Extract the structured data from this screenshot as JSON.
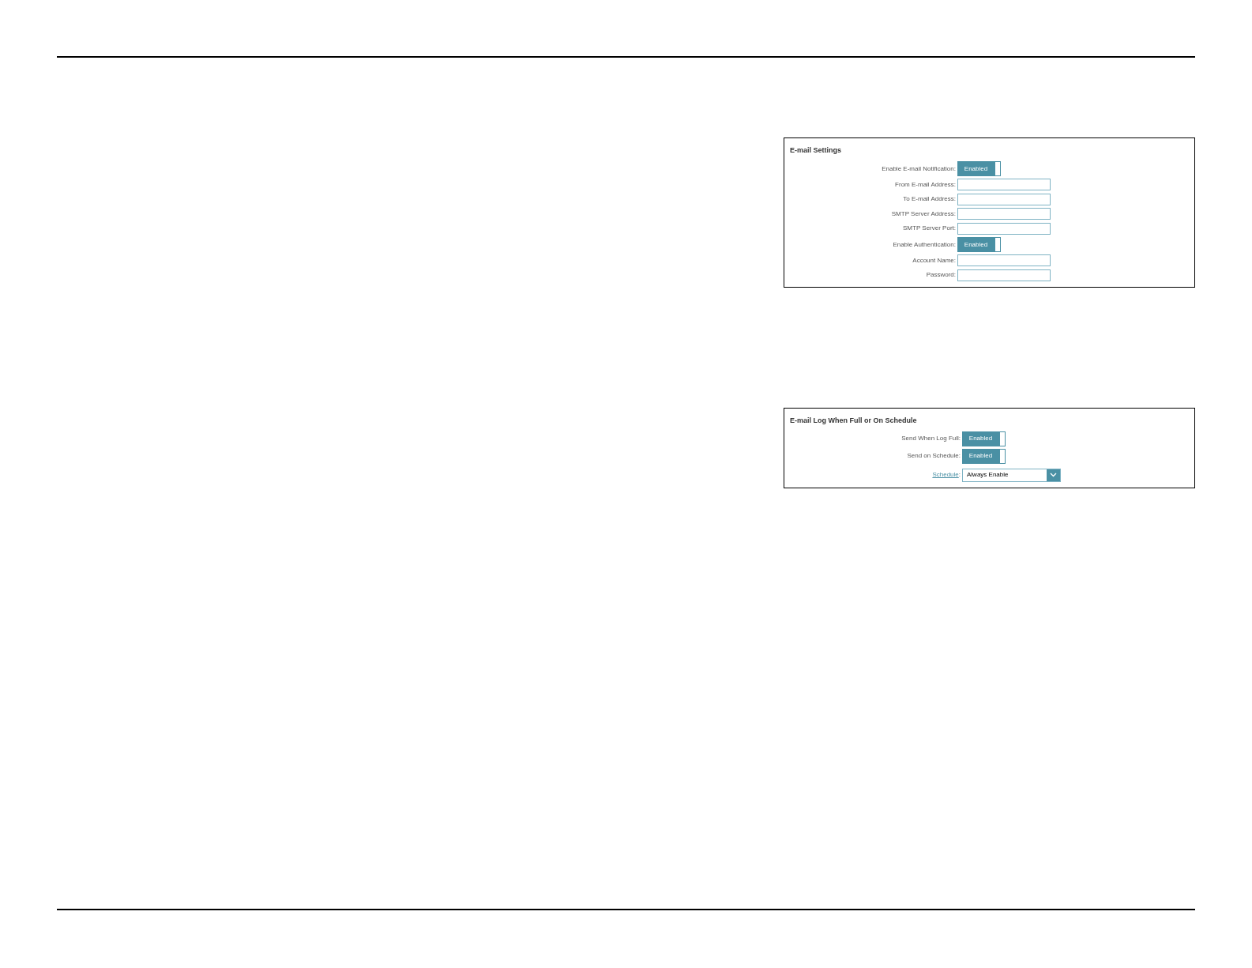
{
  "sections": [
    {
      "title": "E-mail Settings",
      "rows": [
        {
          "kind": "toggle",
          "label": "Enable E-mail Notification:",
          "value": "Enabled",
          "on": true
        },
        {
          "kind": "text",
          "label": "From E-mail Address:"
        },
        {
          "kind": "text",
          "label": "To E-mail Address:"
        },
        {
          "kind": "text",
          "label": "SMTP Server Address:"
        },
        {
          "kind": "text",
          "label": "SMTP Server Port:"
        },
        {
          "kind": "toggle",
          "label": "Enable Authentication:",
          "value": "Enabled",
          "on": true
        },
        {
          "kind": "text",
          "label": "Account Name:"
        },
        {
          "kind": "text",
          "label": "Password:"
        }
      ]
    },
    {
      "title": "E-mail Log When Full or On Schedule",
      "rows": [
        {
          "kind": "toggle",
          "label": "Send When Log Full:",
          "value": "Enabled",
          "on": true
        },
        {
          "kind": "toggle",
          "label": "Send on Schedule:",
          "value": "Enabled",
          "on": true
        },
        {
          "kind": "select",
          "label": "Schedule",
          "suffix": ":",
          "value": "Always Enable"
        }
      ]
    }
  ]
}
